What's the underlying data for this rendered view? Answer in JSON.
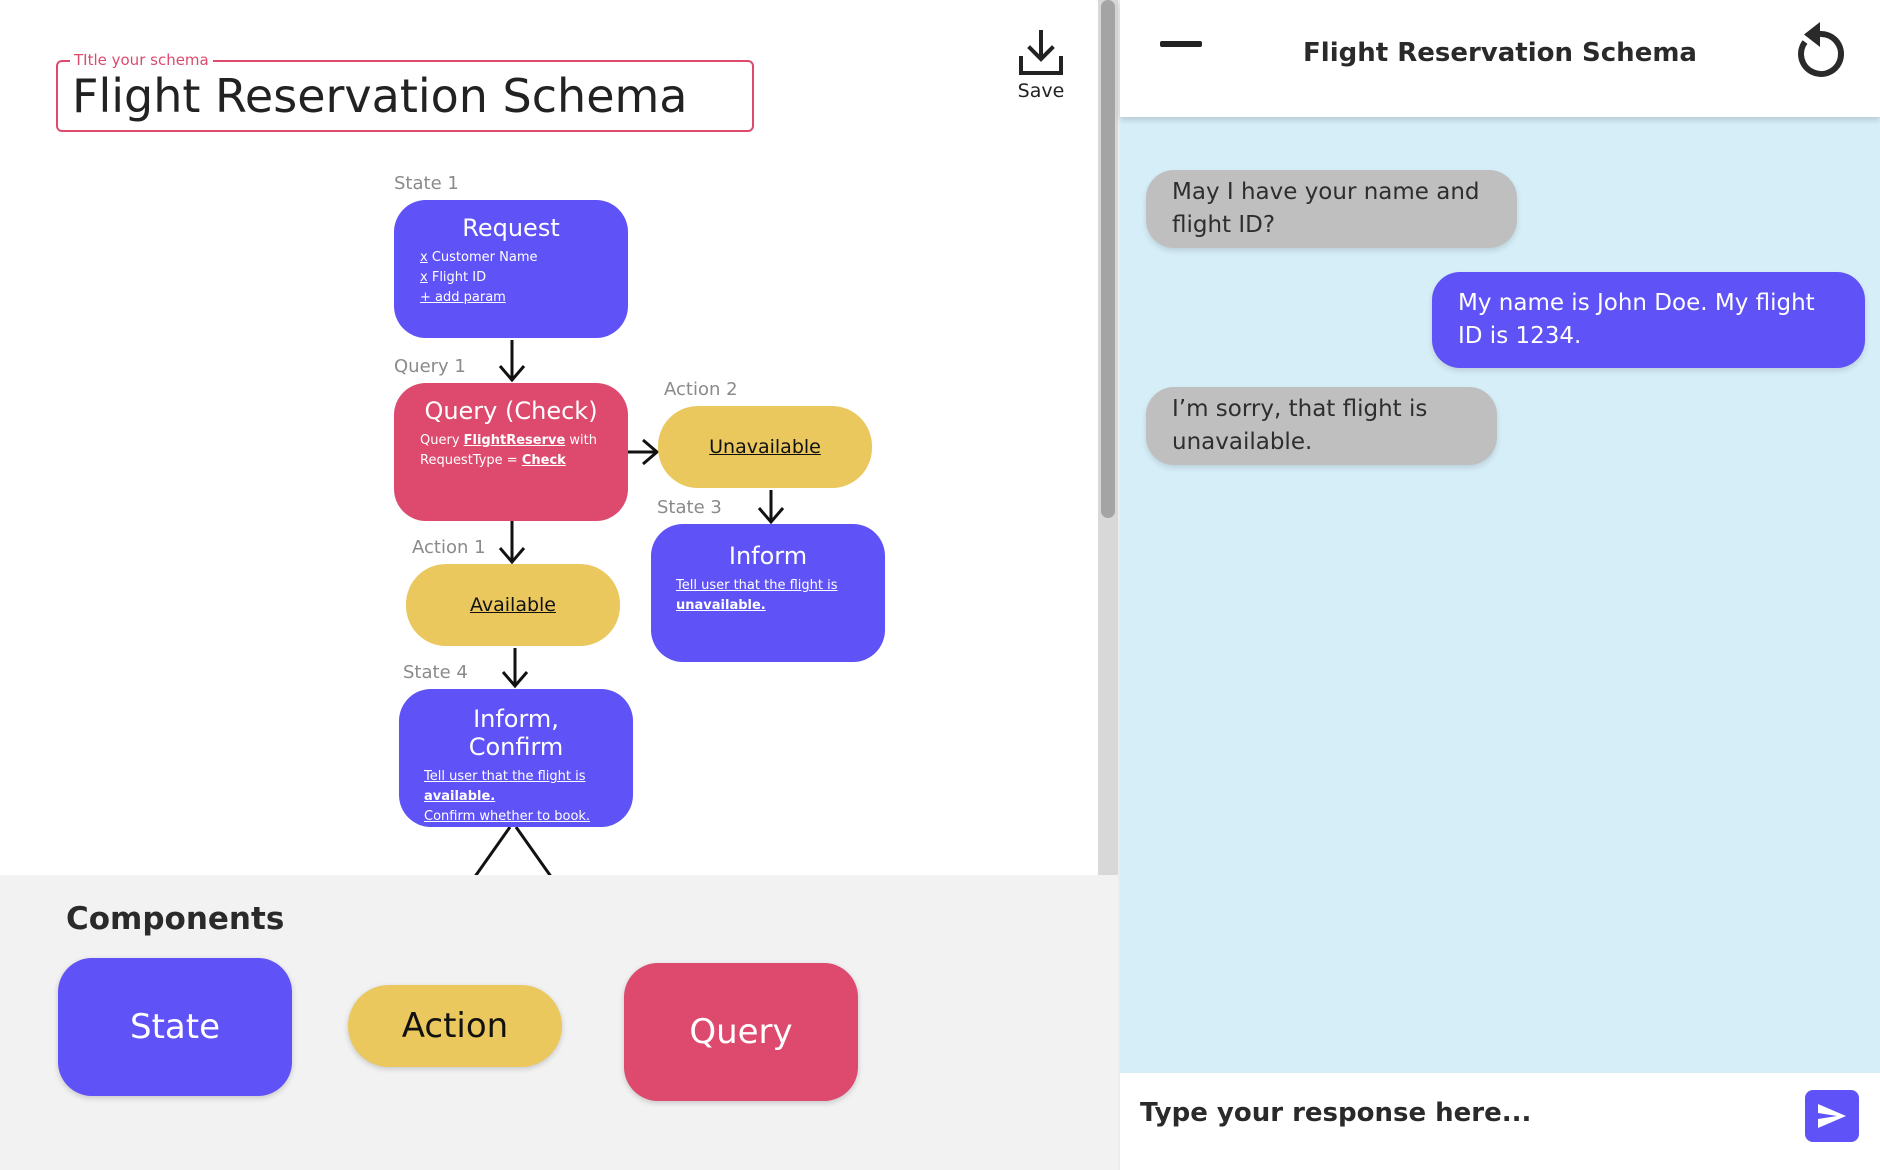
{
  "editor": {
    "title_legend": "TItle your schema",
    "title_value": "Flight Reservation Schema",
    "save_label": "Save"
  },
  "flow": {
    "state1": {
      "caption": "State 1",
      "title": "Request",
      "params": [
        "Customer Name",
        "Flight ID"
      ],
      "param_remove_glyph": "x",
      "add_param": "+ add param"
    },
    "query1": {
      "caption": "Query 1",
      "title": "Query (Check)",
      "text_query": "Query ",
      "text_table": "FlightReserve",
      "text_with": " with",
      "text_reqtype": "RequestType = ",
      "text_check": "Check"
    },
    "action2": {
      "caption": "Action 2",
      "label": "Unavailable"
    },
    "action1": {
      "caption": "Action 1",
      "label": "Available"
    },
    "state3": {
      "caption": "State 3",
      "title": "Inform",
      "line1": "Tell user that the flight is",
      "line2": "unavailable."
    },
    "state4": {
      "caption": "State 4",
      "title": "Inform, Confirm",
      "line1": "Tell user that the flight is",
      "line2": "available.",
      "line3": "Confirm whether to book."
    }
  },
  "palette": {
    "title": "Components",
    "state": "State",
    "action": "Action",
    "query": "Query"
  },
  "chat": {
    "title": "Flight Reservation Schema",
    "messages": [
      {
        "role": "bot",
        "text": "May I have your name and flight ID?"
      },
      {
        "role": "user",
        "text": "My name is John Doe. My flight ID is 1234."
      },
      {
        "role": "bot",
        "text": "I’m sorry, that flight is unavailable."
      }
    ],
    "input_placeholder": "Type your response here..."
  },
  "colors": {
    "state": "#5f52f6",
    "query": "#dd4a6d",
    "action": "#eac85e",
    "chat_bg": "#d6eef8",
    "bot_bubble": "#bfbfbf",
    "user_bubble": "#5f52f6",
    "title_border": "#dc4a6e"
  },
  "icons": {
    "save": "download-icon",
    "minimize": "minus-icon",
    "reset": "refresh-icon",
    "send": "send-icon"
  }
}
